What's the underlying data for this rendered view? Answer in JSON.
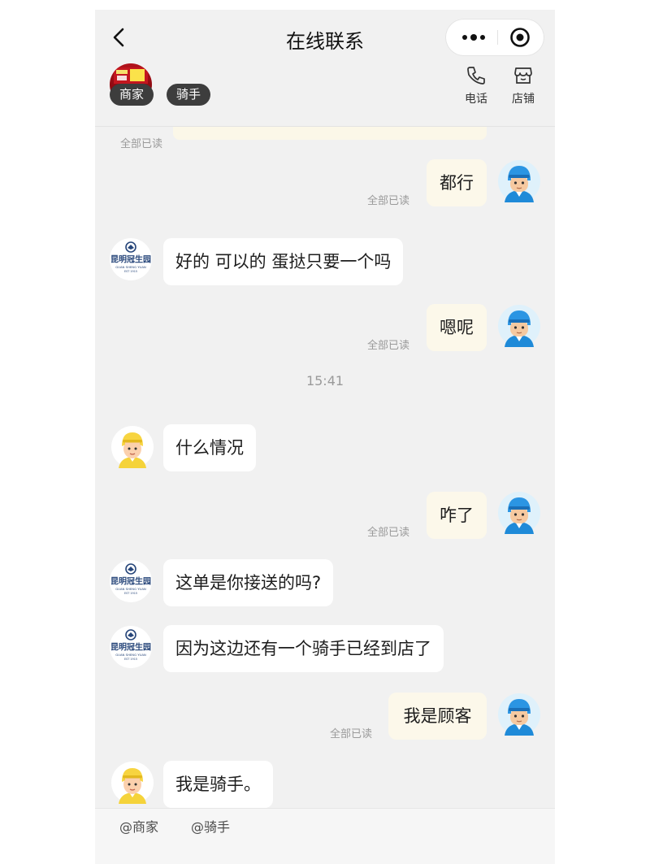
{
  "header": {
    "title": "在线联系",
    "shop_tag": "商家",
    "rider_tag": "骑手",
    "phone_label": "电话",
    "store_label": "店铺"
  },
  "chat": {
    "top_read_status": "全部已读",
    "time_divider": "15:41",
    "messages": [
      {
        "side": "right",
        "sender": "customer",
        "text": "都行",
        "status": "全部已读"
      },
      {
        "side": "left",
        "sender": "merchant",
        "text": "好的 可以的 蛋挞只要一个吗"
      },
      {
        "side": "right",
        "sender": "customer",
        "text": "嗯呢",
        "status": "全部已读"
      },
      {
        "side": "left",
        "sender": "rider",
        "text": "什么情况"
      },
      {
        "side": "right",
        "sender": "customer",
        "text": "咋了",
        "status": "全部已读"
      },
      {
        "side": "left",
        "sender": "merchant",
        "text": "这单是你接送的吗?"
      },
      {
        "side": "left",
        "sender": "merchant",
        "text": "因为这边还有一个骑手已经到店了"
      },
      {
        "side": "right",
        "sender": "customer",
        "text": "我是顾客",
        "status": "全部已读"
      },
      {
        "side": "left",
        "sender": "rider",
        "text": "我是骑手。"
      }
    ]
  },
  "merchant_logo": {
    "name": "昆明冠生园",
    "sub": "GUAN SHENG YUAN",
    "est": "EST 1915"
  },
  "footer": {
    "mention_shop": "@商家",
    "mention_rider": "@骑手"
  },
  "colors": {
    "background": "#f1f1f1",
    "my_bubble": "#fcf8ea",
    "their_bubble": "#ffffff"
  }
}
